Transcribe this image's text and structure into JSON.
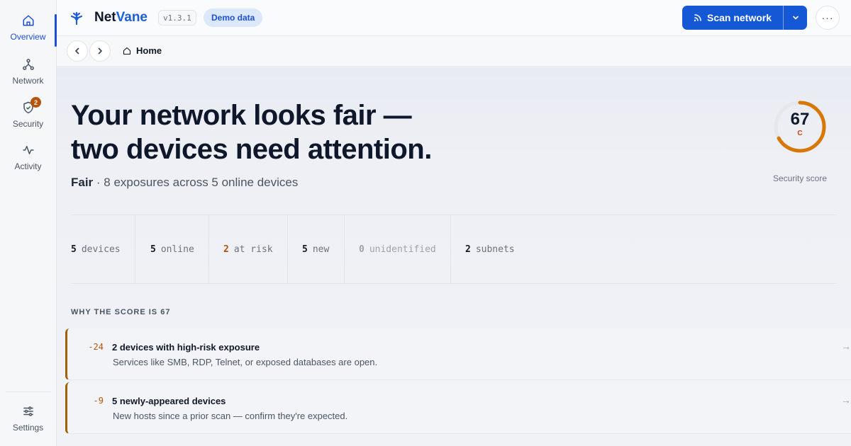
{
  "app": {
    "brand_prefix": "Net",
    "brand_accent": "Vane",
    "version": "v1.3.1",
    "demo_label": "Demo data"
  },
  "colors": {
    "accent": "#1558d6",
    "warning": "#b45309",
    "ring": "#d97706"
  },
  "sidebar": {
    "items": [
      {
        "label": "Overview",
        "icon": "home-icon",
        "active": true
      },
      {
        "label": "Network",
        "icon": "network-icon"
      },
      {
        "label": "Security",
        "icon": "shield-icon",
        "badge": "2"
      },
      {
        "label": "Activity",
        "icon": "activity-icon"
      }
    ],
    "settings_label": "Settings"
  },
  "toolbar": {
    "scan_label": "Scan network",
    "more_label": "···"
  },
  "breadcrumb": {
    "home_label": "Home"
  },
  "hero": {
    "headline_line1": "Your network looks fair —",
    "headline_line2": "two devices need attention.",
    "status_word": "Fair",
    "status_detail": " · 8 exposures across 5 online devices"
  },
  "score": {
    "value": "67",
    "grade": "C",
    "label": "Security score",
    "fraction": 0.67
  },
  "stats": [
    {
      "value": "5",
      "label": "devices"
    },
    {
      "value": "5",
      "label": "online"
    },
    {
      "value": "2",
      "label": "at risk"
    },
    {
      "value": "5",
      "label": "new"
    },
    {
      "value": "0",
      "label": "unidentified"
    },
    {
      "value": "2",
      "label": "subnets"
    }
  ],
  "why": {
    "title": "WHY THE SCORE IS 67",
    "reasons": [
      {
        "delta": "-24",
        "title": "2 devices with high-risk exposure",
        "desc": "Services like SMB, RDP, Telnet, or exposed databases are open.",
        "arrow": "→"
      },
      {
        "delta": "-9",
        "title": "5 newly-appeared devices",
        "desc": "New hosts since a prior scan — confirm they're expected.",
        "arrow": "→"
      }
    ]
  }
}
